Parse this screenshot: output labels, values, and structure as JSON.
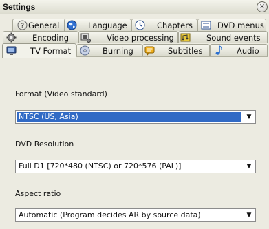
{
  "window": {
    "title": "Settings",
    "close_glyph": "×"
  },
  "tabs": {
    "row1": [
      {
        "label": "General",
        "icon": "question-icon"
      },
      {
        "label": "Language",
        "icon": "globe-icon"
      },
      {
        "label": "Chapters",
        "icon": "clock-icon"
      },
      {
        "label": "DVD menus",
        "icon": "menu-list-icon"
      }
    ],
    "row2": [
      {
        "label": "Encoding",
        "icon": "gear-icon"
      },
      {
        "label": "Video processing",
        "icon": "video-processing-icon"
      },
      {
        "label": "Sound events",
        "icon": "sound-events-icon"
      }
    ],
    "row3": [
      {
        "label": "TV Format",
        "icon": "tv-icon",
        "active": true
      },
      {
        "label": "Burning",
        "icon": "disc-icon"
      },
      {
        "label": "Subtitles",
        "icon": "subtitles-icon"
      },
      {
        "label": "Audio",
        "icon": "music-note-icon"
      }
    ]
  },
  "tv_format": {
    "format": {
      "label": "Format (Video standard)",
      "value": "NTSC (US, Asia)"
    },
    "resolution": {
      "label": "DVD Resolution",
      "value": "Full D1 [720*480 (NTSC) or 720*576 (PAL)]"
    },
    "aspect": {
      "label": "Aspect ratio",
      "value": "Automatic (Program decides AR by source data)"
    }
  },
  "colors": {
    "selection": "#316ac5",
    "tab_bg": "#e4e4d8",
    "panel_bg": "#ecebe1"
  }
}
